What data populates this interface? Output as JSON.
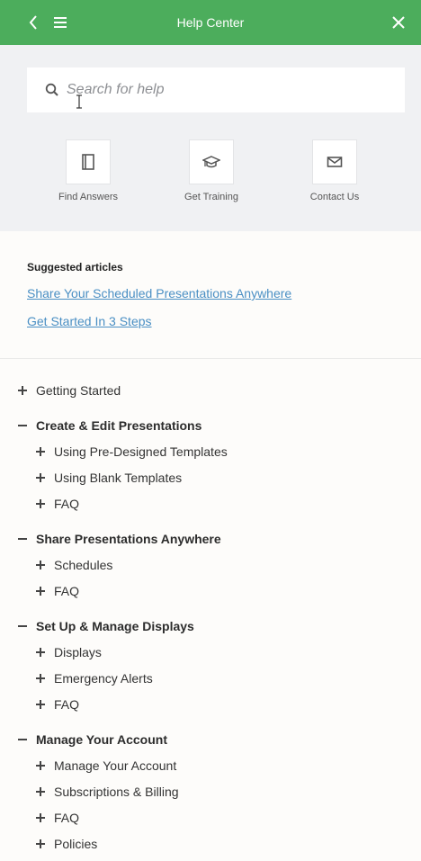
{
  "header": {
    "title": "Help Center"
  },
  "search": {
    "placeholder": "Search for help"
  },
  "quick_links": [
    {
      "label": "Find Answers",
      "icon": "book-icon"
    },
    {
      "label": "Get Training",
      "icon": "graduation-cap-icon"
    },
    {
      "label": "Contact Us",
      "icon": "envelope-icon"
    }
  ],
  "suggested": {
    "heading": "Suggested articles",
    "links": [
      "Share Your Scheduled Presentations Anywhere",
      "Get Started In 3 Steps"
    ]
  },
  "tree": {
    "getting_started": "Getting Started",
    "create_edit": {
      "label": "Create & Edit Presentations",
      "children": [
        "Using Pre-Designed Templates",
        "Using Blank Templates",
        "FAQ"
      ]
    },
    "share": {
      "label": "Share Presentations Anywhere",
      "children": [
        "Schedules",
        "FAQ"
      ]
    },
    "displays": {
      "label": "Set Up & Manage Displays",
      "children": [
        "Displays",
        "Emergency Alerts",
        "FAQ"
      ]
    },
    "account": {
      "label": "Manage Your Account",
      "children": [
        "Manage Your Account",
        "Subscriptions & Billing",
        "FAQ",
        "Policies"
      ]
    }
  }
}
